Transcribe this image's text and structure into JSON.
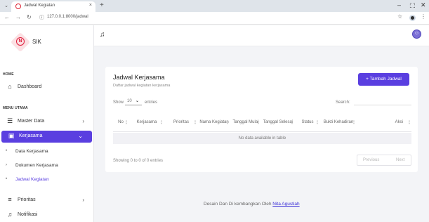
{
  "browser": {
    "tab_title": "Jadwal Kegiatan",
    "tab_close": "×",
    "new_tab": "+",
    "url": "127.0.0.1:8000/jadwal",
    "controls": {
      "minimize": "–",
      "maximize": "⬚",
      "close": "✕"
    }
  },
  "sidebar": {
    "brand": "SIK",
    "section_home": "HOME",
    "dashboard": "Dashboard",
    "section_menu": "MENU UTAMA",
    "master_data": "Master Data",
    "kerjasama": "Kerjasama",
    "sub_items": [
      "Data Kerjasama",
      "Dokumen Kerjasama",
      "Jadwal Kegiatan"
    ],
    "prioritas": "Prioritas",
    "notifikasi": "Notifikasi"
  },
  "card": {
    "title": "Jadwal Kerjasama",
    "subtitle": "Daftar jadwal kegiatan kerjasama",
    "add_button": "+ Tambah Jadwal",
    "show_label": "Show",
    "show_value": "10",
    "entries_label": "entries",
    "search_label": "Search:",
    "search_value": "",
    "columns": [
      "No",
      "Kerjasama",
      "Prioritas",
      "Nama Kegiatan",
      "Tanggal Mulai",
      "Tanggal Selesai",
      "Status",
      "Bukti Kehadiran",
      "Aksi"
    ],
    "empty_message": "No data available in table",
    "info": "Showing 0 to 0 of 0 entries",
    "prev": "Previous",
    "next": "Next"
  },
  "footer": {
    "text": "Desain Dan Di kembangkan Oleh",
    "author": "Nita Agustiah"
  },
  "colors": {
    "accent": "#5a3fe0",
    "brand": "#e01e3c"
  }
}
